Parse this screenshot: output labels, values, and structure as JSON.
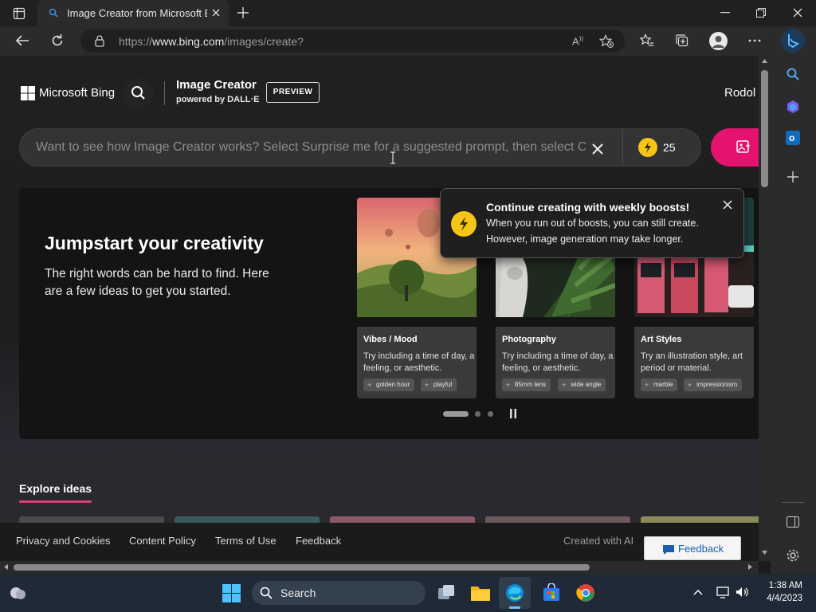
{
  "browser": {
    "tab_title": "Image Creator from Microsoft Bing",
    "url_prefix": "https://",
    "url_domain": "www.bing.com",
    "url_path": "/images/create?"
  },
  "header": {
    "brand": "Microsoft Bing",
    "product_title": "Image Creator",
    "product_subtitle": "powered by DALL·E",
    "preview_badge": "PREVIEW",
    "user_name": "Rodol"
  },
  "prompt": {
    "placeholder": "Want to see how Image Creator works? Select Surprise me for a suggested prompt, then select C",
    "boosts_count": "25"
  },
  "toast": {
    "title": "Continue creating with weekly boosts!",
    "line1": "When you run out of boosts, you can still create.",
    "line2": "However, image generation may take longer."
  },
  "hero": {
    "title": "Jumpstart your creativity",
    "body": "The right words can be hard to find. Here are a few ideas to get you started."
  },
  "cards": [
    {
      "title": "Vibes / Mood",
      "desc": "Try including a time of day, a feeling, or aesthetic.",
      "chips": [
        "golden hour",
        "playful"
      ]
    },
    {
      "title": "Photography",
      "desc": "Try including a time of day, a feeling, or aesthetic.",
      "chips": [
        "85mm lens",
        "wide angle"
      ]
    },
    {
      "title": "Art Styles",
      "desc": "Try an illustration style, art period or material.",
      "chips": [
        "marble",
        "impressionism"
      ]
    }
  ],
  "explore_heading": "Explore ideas",
  "footer": {
    "links": [
      "Privacy and Cookies",
      "Content Policy",
      "Terms of Use",
      "Feedback"
    ],
    "created_with_ai": "Created with AI",
    "feedback_button": "Feedback"
  },
  "taskbar": {
    "search_label": "Search",
    "time": "1:38 AM",
    "date": "4/4/2023"
  },
  "colors": {
    "accent_pink": "#e3136f",
    "boost_yellow": "#f5c518",
    "explore_underline": "#e03e7a",
    "feedback_blue": "#1a5fb4"
  }
}
